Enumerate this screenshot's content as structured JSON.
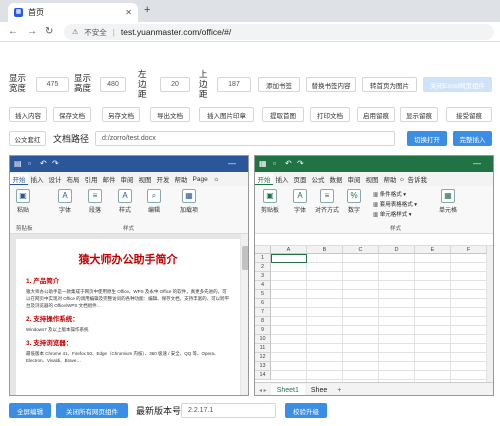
{
  "browser": {
    "tab_title": "首页",
    "tab_icon": "document-icon",
    "close_icon": "close-icon",
    "new_tab": "+",
    "not_secure": "不安全",
    "url": "test.yuanmaster.com/office/#/"
  },
  "controls": {
    "display_width_label": "显示宽度",
    "display_width_value": "475",
    "display_height_label": "显示高度",
    "display_height_value": "480",
    "left_margin_label": "左边距",
    "left_margin_value": "20",
    "top_margin_label": "上边距",
    "top_margin_value": "187",
    "add_bookmark": "添加书签",
    "replace_bookmark": "替换书签内容",
    "doc_to_image": "转首页为图片",
    "close_excel": "关闭Excel网页组件",
    "insert_content": "插入内容",
    "save_doc": "保存文档",
    "save_as": "另存文档",
    "export_doc": "导出文档",
    "insert_image": "插入图片印章",
    "extract_first": "提取首图",
    "print_doc": "打印文档",
    "enable_trace": "启用留痕",
    "show_trace": "显示留痕",
    "accept_trace": "接受留痕",
    "red_header": "公文套红",
    "doc_path_label": "文档路径",
    "doc_path_value": "d:/zorro/test.docx",
    "switch_open": "切换打开",
    "full_insert": "完整插入"
  },
  "word": {
    "tabs": [
      "开始",
      "插入",
      "设计",
      "布局",
      "引用",
      "邮件",
      "审阅",
      "视图",
      "开发",
      "帮助",
      "Page"
    ],
    "ribbon": [
      {
        "label": "粘贴",
        "icon": "paste-icon"
      },
      {
        "label": "字体",
        "icon": "font-icon"
      },
      {
        "label": "段落",
        "icon": "paragraph-icon"
      },
      {
        "label": "样式",
        "icon": "styles-icon"
      },
      {
        "label": "编辑",
        "icon": "edit-icon"
      },
      {
        "label": "加载项",
        "icon": "addin-icon"
      }
    ],
    "group_clipboard": "剪贴板",
    "group_styles": "样式",
    "group_addins": "加载项",
    "doc_title": "猿大师办公助手简介",
    "h1": "1. 产品简介",
    "p1": "猿大师办公助手是一款集成于网页中使用原生 Office、WPS 及永中 Office 的软件，真更多先进的，可以在网页中实现对 Office 的调用编辑及完整访问的各种功能：编辑、保存文档，支持丰富的、可以跨平台及浏览器的 Office/WPS 文档组件…",
    "h2": "2. 支持操作系统：",
    "p2": "Windows7 及以上版本操作系统",
    "h3": "3. 支持浏览器：",
    "p3": "最低版本 Chrome 41、Firefox 50、Edge（Chromium 内核）、360 极速 / 安全、QQ 等、Opera、Electron、Vivaldi、Brave…"
  },
  "excel": {
    "tabs": [
      "开始",
      "插入",
      "页面",
      "公式",
      "数据",
      "审阅",
      "视图",
      "帮助",
      "告诉我"
    ],
    "ribbon": [
      {
        "label": "剪贴板",
        "icon": "clipboard-icon"
      },
      {
        "label": "字体",
        "icon": "font-icon"
      },
      {
        "label": "对齐方式",
        "icon": "align-icon"
      },
      {
        "label": "数字",
        "icon": "number-icon"
      },
      {
        "label": "单元格",
        "icon": "cells-icon"
      }
    ],
    "cond_format": "条件格式",
    "table_format": "套用表格格式",
    "cell_style": "单元格样式",
    "group_styles": "样式",
    "columns": [
      "A",
      "B",
      "C",
      "D",
      "E",
      "F"
    ],
    "rows": [
      "1",
      "2",
      "3",
      "4",
      "5",
      "6",
      "7",
      "8",
      "9",
      "10",
      "11",
      "12",
      "13",
      "14"
    ],
    "sheet1": "Sheet1",
    "sheet2": "Shee",
    "add_sheet": "+"
  },
  "bottom": {
    "fullscreen": "全屏编辑",
    "close_all": "关闭所有网页组件",
    "latest_version_label": "最新版本号",
    "version_value": "2.2.17.1",
    "upgrade": "校验升级"
  },
  "colors": {
    "accent": "#3a8ee6",
    "word_blue": "#2b579a",
    "excel_green": "#217346",
    "title_red": "#c00000"
  }
}
